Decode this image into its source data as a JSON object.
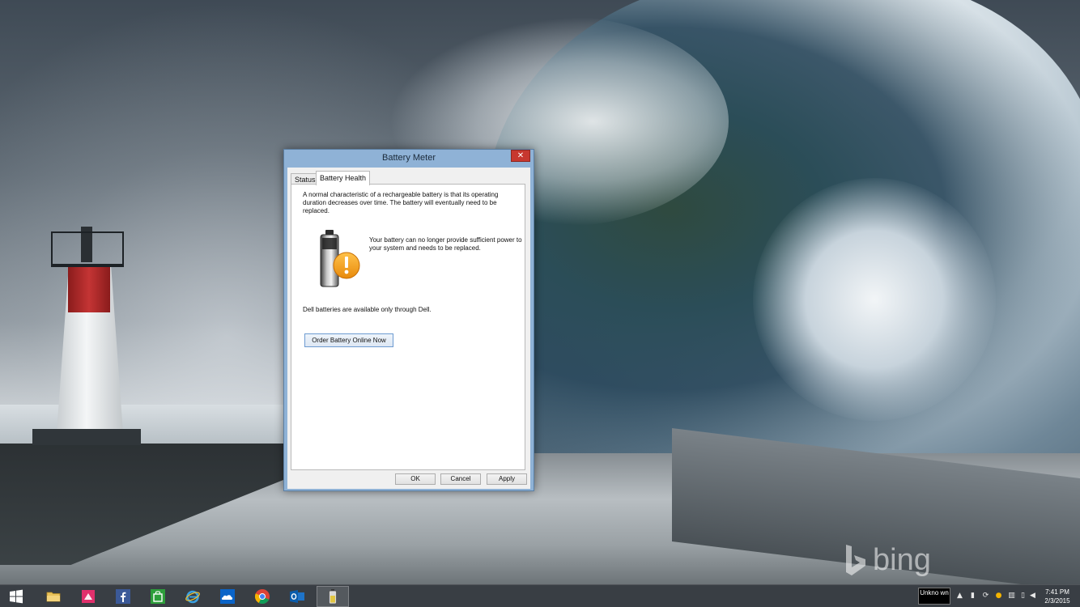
{
  "desktop": {
    "bing_watermark": "bing"
  },
  "dialog": {
    "title": "Battery Meter",
    "close_glyph": "✕",
    "tabs": [
      {
        "label": "Status",
        "selected": false
      },
      {
        "label": "Battery Health",
        "selected": true
      }
    ],
    "intro_text": "A normal characteristic of a rechargeable battery is that its operating duration decreases over time. The battery will eventually need to be replaced.",
    "icon": "battery-warning-icon",
    "replace_message": "Your battery can no longer provide sufficient power to your system and needs to be replaced.",
    "dell_text": "Dell batteries are available only through Dell.",
    "order_button": "Order Battery Online Now",
    "buttons": {
      "ok": "OK",
      "cancel": "Cancel",
      "apply": "Apply"
    }
  },
  "taskbar": {
    "pinned": [
      {
        "name": "file-explorer",
        "icon": "folder-icon"
      },
      {
        "name": "store",
        "icon": "store-icon"
      },
      {
        "name": "facebook",
        "icon": "facebook-icon"
      },
      {
        "name": "windows-store",
        "icon": "shopping-bag-icon"
      },
      {
        "name": "internet-explorer",
        "icon": "ie-icon"
      },
      {
        "name": "onedrive",
        "icon": "cloud-icon"
      },
      {
        "name": "chrome",
        "icon": "chrome-icon"
      },
      {
        "name": "outlook",
        "icon": "outlook-icon"
      },
      {
        "name": "battery-meter",
        "icon": "battery-icon",
        "active": true
      }
    ],
    "tray_label": "Unkno wn",
    "tray_icons": [
      "up-arrow-icon",
      "signal-icon",
      "sync-icon",
      "chrome-tray-icon",
      "network-icon",
      "battery-tray-icon",
      "volume-icon"
    ],
    "time": "7:41 PM",
    "date": "2/3/2015"
  },
  "colors": {
    "window_frame": "#8fb2d6",
    "close_button": "#c7372f",
    "button_focus_border": "#6d9bd1",
    "taskbar": "#2e343a",
    "warning_orange": "#f2a31b"
  }
}
